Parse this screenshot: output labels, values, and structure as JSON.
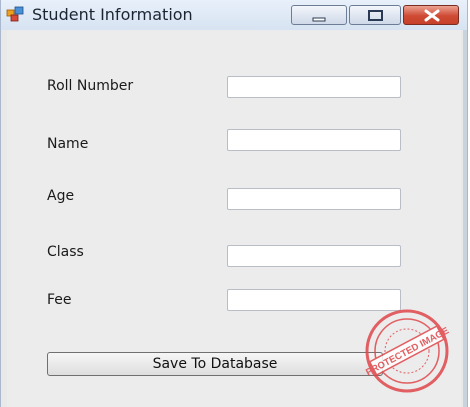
{
  "window": {
    "title": "Student Information",
    "icon": "form-app-icon",
    "controls": [
      "minimize-icon",
      "maximize-icon",
      "close-icon"
    ]
  },
  "form": {
    "fields": [
      {
        "label": "Roll Number",
        "value": "",
        "placeholder": ""
      },
      {
        "label": "Name",
        "value": "",
        "placeholder": ""
      },
      {
        "label": "Age",
        "value": "",
        "placeholder": ""
      },
      {
        "label": "Class",
        "value": "",
        "placeholder": ""
      },
      {
        "label": "Fee",
        "value": "",
        "placeholder": ""
      }
    ],
    "save_label": "Save To Database"
  },
  "watermark": {
    "text": "PROTECTED IMAGE",
    "color": "#e0474b"
  },
  "colors": {
    "window_background": "#ececec",
    "title_text": "#1b2433",
    "close_button": "#cf4b34"
  }
}
